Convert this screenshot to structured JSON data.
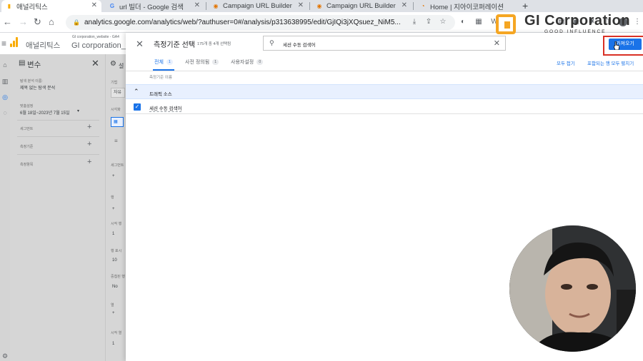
{
  "browser": {
    "tabs": [
      {
        "title": "애널리틱스",
        "active": true,
        "favicon": "analytics-icon"
      },
      {
        "title": "url 빌더 - Google 검색",
        "active": false,
        "favicon": "google-g-icon"
      },
      {
        "title": "Campaign URL Builder",
        "active": false,
        "favicon": "campaign-icon"
      },
      {
        "title": "Campaign URL Builder",
        "active": false,
        "favicon": "campaign-icon"
      },
      {
        "title": "Home | 지아이코퍼레이션",
        "active": false,
        "favicon": "home-icon"
      }
    ],
    "url": "analytics.google.com/analytics/web/?authuser=0#/analysis/p313638995/edit/GjIQi3jXQsuez_NiM5..."
  },
  "overlay_logo": {
    "name": "GI Corporation",
    "tagline": "GOOD INFLUENCE"
  },
  "ga_header": {
    "product": "애널리틱스",
    "property_account": "GI corporation_website - GA4",
    "property_name": "GI corporation_w"
  },
  "variables_panel": {
    "title": "변수",
    "exploration_name_label": "탐색 분석 이름:",
    "exploration_name": "제목 없는 탐색 분석",
    "custom_label": "맞춤설정",
    "date_range": "6월 18일~2023년 7월 15일",
    "sections": [
      "세그먼트",
      "측정기준",
      "측정항목"
    ]
  },
  "settings_strip": {
    "labels": [
      "기법",
      "자유",
      "시각화",
      "세그먼트",
      "행",
      "시작 행",
      "행 표시",
      "중첩된 행",
      "열",
      "시작 열"
    ],
    "values": [
      "1",
      "10",
      "No",
      "1"
    ]
  },
  "dialog": {
    "title": "측정기준 선택",
    "selection_count": "175개 중 4개 선택됨",
    "search_value": "세션 수동 검색어",
    "apply_label": "가져오기",
    "tabs": [
      {
        "label": "전체",
        "count": "1",
        "active": true
      },
      {
        "label": "사전 정의됨",
        "count": "1",
        "active": false
      },
      {
        "label": "사용자설정",
        "count": "0",
        "active": false
      }
    ],
    "collapse_all": "모두 접기",
    "expand_all": "포함되는 행 모두 펼치기",
    "column_header": "측정기준 이름",
    "group": "트래픽 소스",
    "item": "세션 수동 검색어"
  },
  "colors": {
    "accent": "#1a73e8",
    "highlight_border": "#d93025",
    "selected_row": "#e8f0fe",
    "logo_orange": "#f5a623"
  }
}
